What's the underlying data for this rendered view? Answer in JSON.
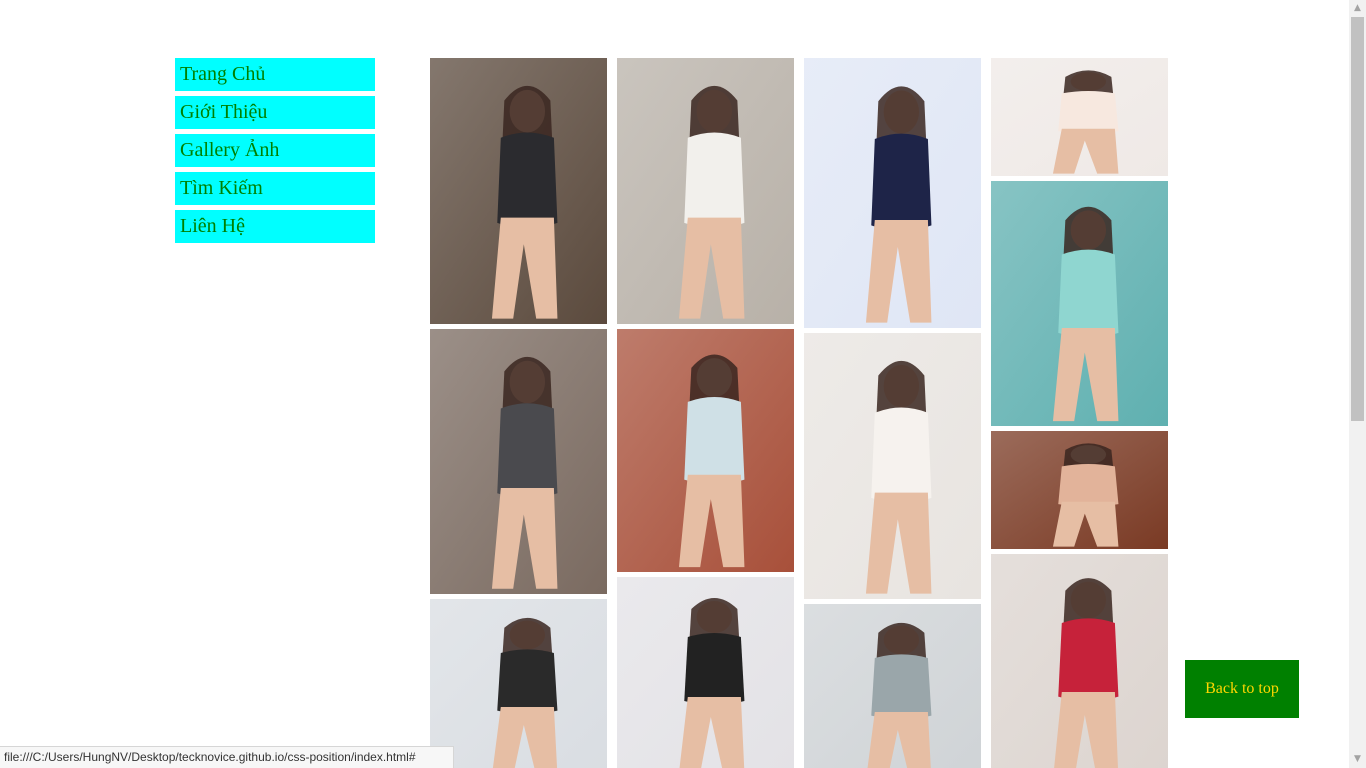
{
  "nav": {
    "items": [
      {
        "label": "Trang Chủ"
      },
      {
        "label": "Giới Thiệu"
      },
      {
        "label": "Gallery Ảnh"
      },
      {
        "label": "Tìm Kiếm"
      },
      {
        "label": "Liên Hệ"
      }
    ]
  },
  "gallery": {
    "columns": [
      [
        {
          "icon": "photo-icon",
          "bg": "#5b4a3d",
          "accent": "#2b2b2f"
        },
        {
          "icon": "photo-icon",
          "bg": "#7a6a60",
          "accent": "#4a4a4e"
        },
        {
          "icon": "photo-icon",
          "bg": "#d9dde2",
          "accent": "#2a2a2a"
        }
      ],
      [
        {
          "icon": "photo-icon",
          "bg": "#b8b1a8",
          "accent": "#f2f0ec"
        },
        {
          "icon": "photo-icon",
          "bg": "#a8503a",
          "accent": "#cfe0e6"
        },
        {
          "icon": "photo-icon",
          "bg": "#e3e2e6",
          "accent": "#222222"
        }
      ],
      [
        {
          "icon": "photo-icon",
          "bg": "#dfe6f5",
          "accent": "#1e2448"
        },
        {
          "icon": "photo-icon",
          "bg": "#e8e4e0",
          "accent": "#f6f2ee"
        },
        {
          "icon": "photo-icon",
          "bg": "#cfd3d6",
          "accent": "#9aa6aa"
        }
      ],
      [
        {
          "icon": "photo-icon",
          "bg": "#efe9e6",
          "accent": "#f7e8df"
        },
        {
          "icon": "photo-icon",
          "bg": "#5fb0b0",
          "accent": "#8fd6d0"
        },
        {
          "icon": "photo-icon",
          "bg": "#7a3a24",
          "accent": "#e2b39a"
        },
        {
          "icon": "photo-icon",
          "bg": "#dcd4cf",
          "accent": "#c6223a"
        }
      ]
    ]
  },
  "back_to_top": {
    "label": "Back to top"
  },
  "statusbar": {
    "url": "file:///C:/Users/HungNV/Desktop/tecknovice.github.io/css-position/index.html#"
  },
  "colors": {
    "nav_bg": "#00ffff",
    "nav_text": "#008000",
    "button_bg": "#008000",
    "button_text": "#ffd700"
  }
}
